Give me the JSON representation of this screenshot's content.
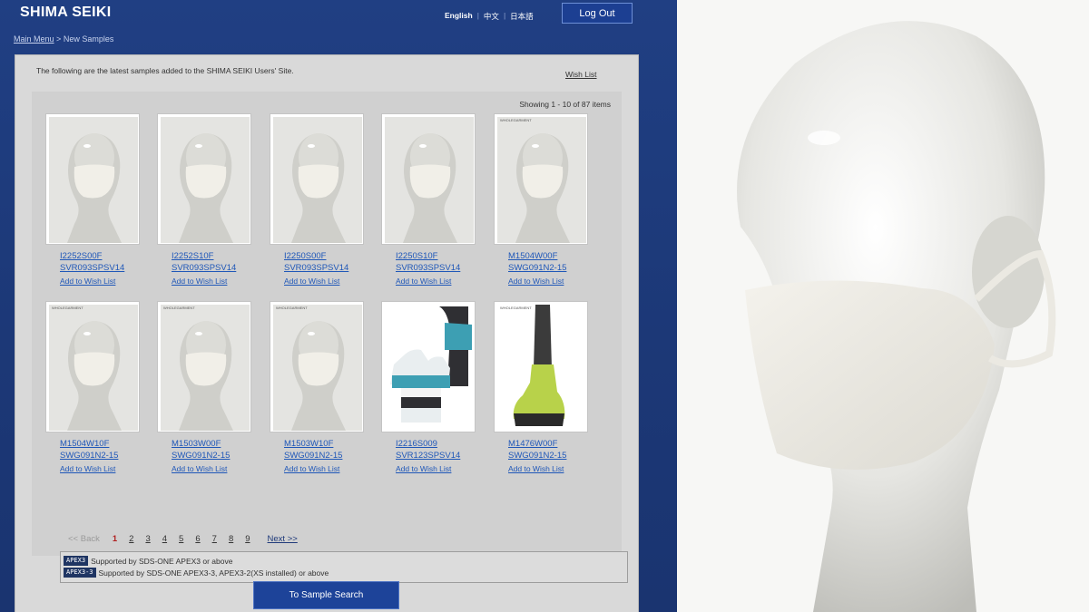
{
  "header": {
    "logo": "SHIMA SEIKI",
    "languages": [
      "English",
      "中文",
      "日本語"
    ],
    "active_language": "English",
    "logout_label": "Log Out"
  },
  "breadcrumb": {
    "home": "Main Menu",
    "separator": ">",
    "current": "New Samples"
  },
  "intro_text": "The following are the latest samples added to the SHIMA SEIKI Users' Site.",
  "wish_list_label": "Wish List",
  "showing_text": "Showing 1 - 10 of 87 items",
  "add_to_wish_label": "Add to Wish List",
  "samples": [
    {
      "code": "I2252S00F",
      "system": "SVR093SPSV14",
      "image": "mask-mannequin-icon",
      "tag": ""
    },
    {
      "code": "I2252S10F",
      "system": "SVR093SPSV14",
      "image": "mask-mannequin-icon",
      "tag": ""
    },
    {
      "code": "I2250S00F",
      "system": "SVR093SPSV14",
      "image": "mask-mannequin-icon",
      "tag": ""
    },
    {
      "code": "I2250S10F",
      "system": "SVR093SPSV14",
      "image": "mask-mannequin-icon",
      "tag": ""
    },
    {
      "code": "M1504W00F",
      "system": "SWG091N2-15",
      "image": "mask-mannequin-icon",
      "tag": "WHOLEGARMENT"
    },
    {
      "code": "M1504W10F",
      "system": "SWG091N2-15",
      "image": "mask-mannequin-icon",
      "tag": "WHOLEGARMENT"
    },
    {
      "code": "M1503W00F",
      "system": "SWG091N2-15",
      "image": "mask-mannequin-icon",
      "tag": "WHOLEGARMENT"
    },
    {
      "code": "M1503W10F",
      "system": "SWG091N2-15",
      "image": "mask-mannequin-icon",
      "tag": "WHOLEGARMENT"
    },
    {
      "code": "I2216S009",
      "system": "SVR123SPSV14",
      "image": "polo-shirt-icon",
      "tag": ""
    },
    {
      "code": "M1476W00F",
      "system": "SWG091N2-15",
      "image": "sock-icon",
      "tag": "WHOLEGARMENT"
    }
  ],
  "pagination": {
    "back_label": "<< Back",
    "pages": [
      "1",
      "2",
      "3",
      "4",
      "5",
      "6",
      "7",
      "8",
      "9"
    ],
    "current": "1",
    "next_label": "Next >>"
  },
  "support": [
    {
      "badge": "APEX3",
      "text": "Supported by SDS-ONE APEX3 or above"
    },
    {
      "badge": "APEX3-3",
      "text": "Supported by SDS-ONE APEX3-3, APEX3-2(XS installed) or above"
    }
  ],
  "search_button_label": "To Sample Search",
  "colors": {
    "brand_blue": "#1e3a78",
    "link": "#1f57b8",
    "current_page": "#b01e1e",
    "panel": "#d9d9d9"
  }
}
